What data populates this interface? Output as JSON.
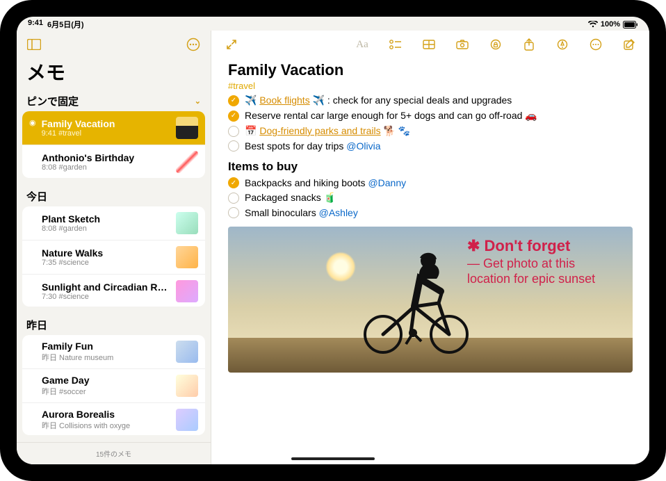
{
  "status": {
    "time": "9:41",
    "date": "6月5日(月)",
    "battery": "100%"
  },
  "sidebar": {
    "title": "メモ",
    "sections": [
      {
        "header": "ピンで固定",
        "items": [
          {
            "title": "Family Vacation",
            "meta": "9:41  #travel",
            "pinned": true,
            "selected": true
          },
          {
            "title": "Anthonio's Birthday",
            "meta": "8:08  #garden"
          }
        ]
      },
      {
        "header": "今日",
        "items": [
          {
            "title": "Plant Sketch",
            "meta": "8:08  #garden"
          },
          {
            "title": "Nature Walks",
            "meta": "7:35  #science"
          },
          {
            "title": "Sunlight and Circadian Rhy...",
            "meta": "7:30  #science"
          }
        ]
      },
      {
        "header": "昨日",
        "items": [
          {
            "title": "Family Fun",
            "meta": "昨日  Nature museum"
          },
          {
            "title": "Game Day",
            "meta": "昨日  #soccer"
          },
          {
            "title": "Aurora Borealis",
            "meta": "昨日  Collisions with oxyge"
          }
        ]
      }
    ],
    "footer": "15件のメモ"
  },
  "note": {
    "title": "Family Vacation",
    "tag": "#travel",
    "checklist1": [
      {
        "done": true,
        "pre_emoji": "✈️",
        "link": "Book flights",
        "post_emoji": "✈️",
        "rest": ": check for any special deals and upgrades"
      },
      {
        "done": true,
        "text": "Reserve rental car large enough for 5+ dogs and can go off-road 🚗"
      },
      {
        "done": false,
        "calendar": true,
        "link": "Dog-friendly parks and trails",
        "post_emoji": " 🐕 🐾"
      },
      {
        "done": false,
        "text_pre": "Best spots for day trips ",
        "mention": "@Olivia"
      }
    ],
    "subhead": "Items to buy",
    "checklist2": [
      {
        "done": true,
        "text_pre": "Backpacks and hiking boots ",
        "mention": "@Danny"
      },
      {
        "done": false,
        "text": "Packaged snacks 🧃"
      },
      {
        "done": false,
        "text_pre": "Small binoculars ",
        "mention": "@Ashley"
      }
    ],
    "handwriting": {
      "line1": "✱ Don't forget",
      "line2": "— Get photo at this location for epic sunset"
    }
  }
}
